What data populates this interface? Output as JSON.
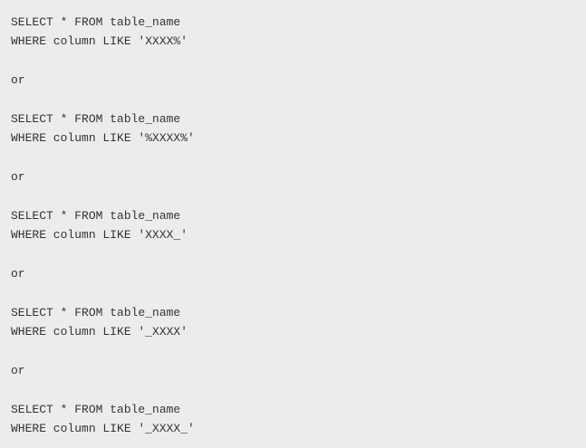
{
  "code": {
    "lines": [
      "SELECT * FROM table_name",
      "WHERE column LIKE 'XXXX%'",
      "",
      "or",
      "",
      "SELECT * FROM table_name",
      "WHERE column LIKE '%XXXX%'",
      "",
      "or",
      "",
      "SELECT * FROM table_name",
      "WHERE column LIKE 'XXXX_'",
      "",
      "or",
      "",
      "SELECT * FROM table_name",
      "WHERE column LIKE '_XXXX'",
      "",
      "or",
      "",
      "SELECT * FROM table_name",
      "WHERE column LIKE '_XXXX_'"
    ]
  }
}
